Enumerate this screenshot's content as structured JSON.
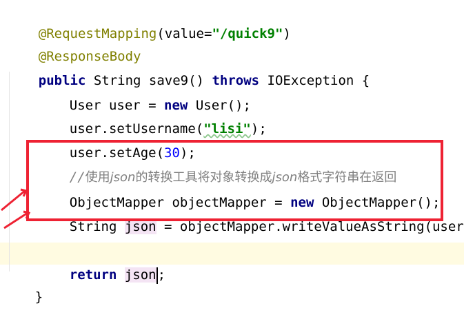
{
  "lines": {
    "l1": {
      "annotation": "@RequestMapping",
      "p1": "(value=",
      "str": "\"/quick9\"",
      "p2": ")"
    },
    "l2": {
      "annotation": "@ResponseBody"
    },
    "l3": {
      "kw1": "public",
      "t1": " String save9() ",
      "kw2": "throws",
      "t2": " IOException {"
    },
    "l4": {
      "t1": "User user = ",
      "kw": "new",
      "t2": " User();"
    },
    "l5": {
      "t1": "user.setUsername(",
      "str": "\"lisi\"",
      "t2": ");"
    },
    "l6": {
      "t1": "user.setAge(",
      "num": "30",
      "t2": ");"
    },
    "l7": {
      "c1": "//",
      "c2": "使用",
      "c3": "json",
      "c4": "的转换工具将对象转换成",
      "c5": "json",
      "c6": "格式字符串在返回"
    },
    "l8": {
      "t1": "ObjectMapper objectMapper = ",
      "kw": "new",
      "t2": " ObjectMapper();"
    },
    "l9": {
      "t1": "String ",
      "var": "json",
      "t2": " = objectMapper.writeValueAsString(user);"
    },
    "l10": {
      "kw": "return",
      "t1": " ",
      "var": "json",
      "t2": ";"
    },
    "l11": {
      "t1": "}"
    }
  },
  "colors": {
    "annotation": "#808000",
    "keyword": "#000080",
    "string": "#008000",
    "number": "#0000ff",
    "comment": "#808080",
    "highlight_box": "#ee2233"
  }
}
